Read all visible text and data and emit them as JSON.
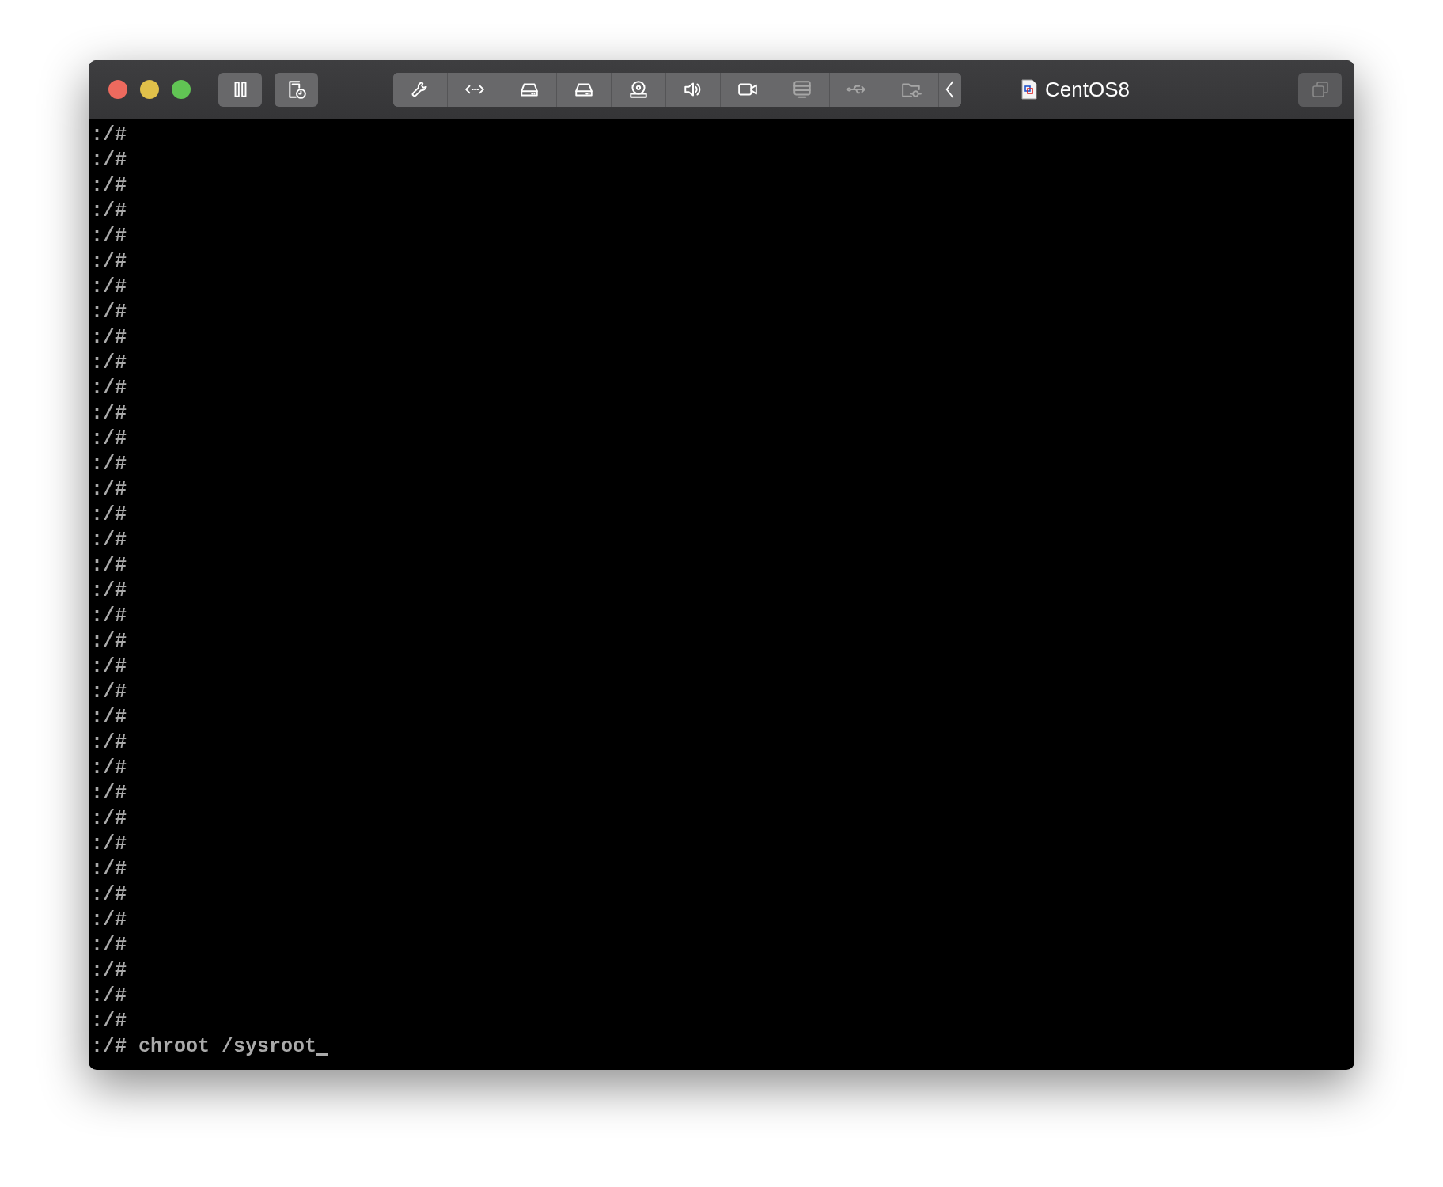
{
  "window": {
    "title": "CentOS8"
  },
  "controls": [
    {
      "kind": "pause"
    },
    {
      "kind": "snapshot"
    }
  ],
  "toolbar": [
    {
      "kind": "settings",
      "disabled": false
    },
    {
      "kind": "network",
      "disabled": false
    },
    {
      "kind": "disk",
      "disabled": false
    },
    {
      "kind": "disk",
      "disabled": false
    },
    {
      "kind": "optical",
      "disabled": false
    },
    {
      "kind": "audio",
      "disabled": false
    },
    {
      "kind": "camera",
      "disabled": false
    },
    {
      "kind": "display",
      "disabled": true
    },
    {
      "kind": "usb",
      "disabled": true
    },
    {
      "kind": "shared-folder",
      "disabled": true
    },
    {
      "kind": "collapse",
      "disabled": false
    }
  ],
  "terminal": {
    "lines": [
      ":/#",
      ":/#",
      ":/#",
      ":/#",
      ":/#",
      ":/#",
      ":/#",
      ":/#",
      ":/#",
      ":/#",
      ":/#",
      ":/#",
      ":/#",
      ":/#",
      ":/#",
      ":/#",
      ":/#",
      ":/#",
      ":/#",
      ":/#",
      ":/#",
      ":/#",
      ":/#",
      ":/#",
      ":/#",
      ":/#",
      ":/#",
      ":/#",
      ":/#",
      ":/#",
      ":/#",
      ":/#",
      ":/#",
      ":/#",
      ":/#",
      ":/#",
      ":/# chroot /sysroot"
    ],
    "cursor": true
  }
}
